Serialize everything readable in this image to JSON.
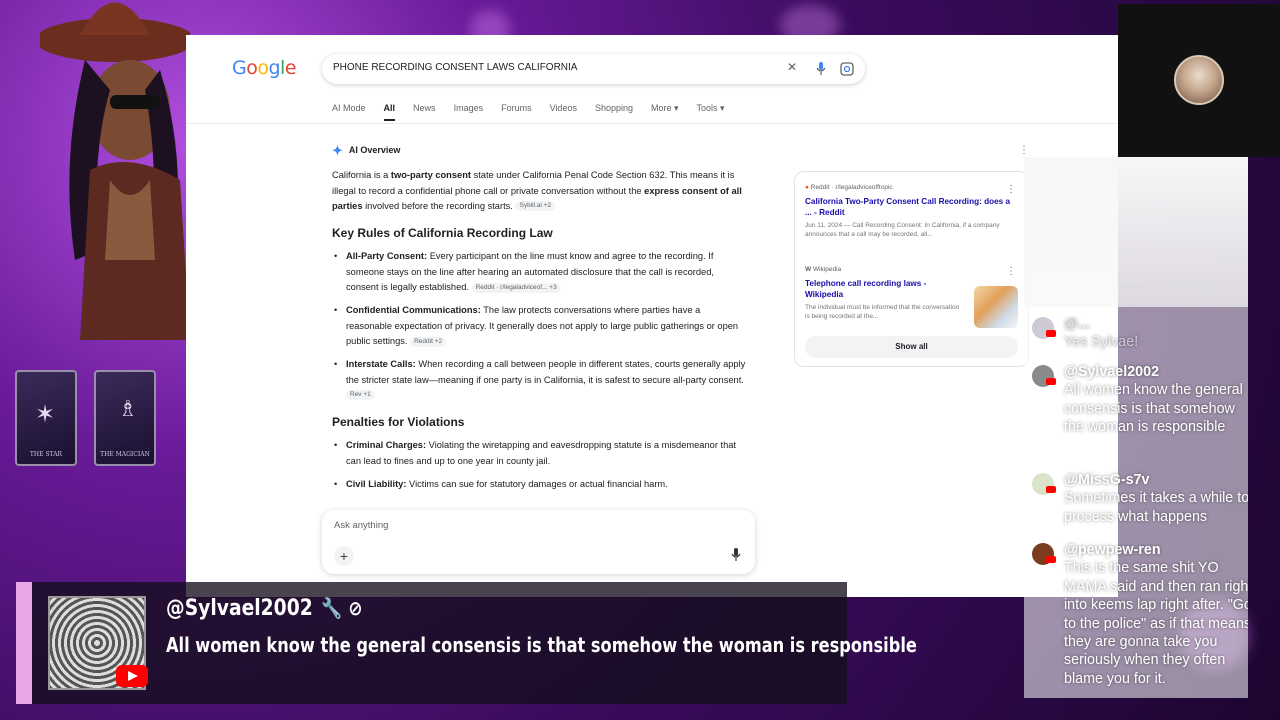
{
  "search": {
    "query": "PHONE RECORDING CONSENT LAWS CALIFORNIA",
    "tabs": [
      "AI Mode",
      "All",
      "News",
      "Images",
      "Forums",
      "Videos",
      "Shopping",
      "More ▾",
      "Tools ▾"
    ]
  },
  "overview": {
    "header": "AI Overview",
    "intro_1": "California is a ",
    "intro_bold_1": "two-party consent",
    "intro_2": " state under California Penal Code Section 632. This means it is illegal to record a confidential phone call or private conversation without the ",
    "intro_bold_2": "express consent of all parties",
    "intro_3": " involved before the recording starts.",
    "intro_chip": "Sybill.ai +2",
    "key_rules_heading": "Key Rules of California Recording Law",
    "rules": [
      {
        "title": "All-Party Consent:",
        "text": " Every participant on the line must know and agree to the recording. If someone stays on the line after hearing an automated disclosure that the call is recorded, consent is legally established.",
        "chip": "Reddit · r/legaladviceof... +3"
      },
      {
        "title": "Confidential Communications:",
        "text": " The law protects conversations where parties have a reasonable expectation of privacy. It generally does not apply to large public gatherings or open public settings.",
        "chip": "Reddit +2"
      },
      {
        "title": "Interstate Calls:",
        "text": " When recording a call between people in different states, courts generally apply the stricter state law—meaning if one party is in California, it is safest to secure all-party consent.",
        "chip": "Rev +1"
      }
    ],
    "penalties_heading": "Penalties for Violations",
    "penalties": [
      {
        "title": "Criminal Charges:",
        "text": " Violating the wiretapping and eavesdropping statute is a misdemeanor that can lead to fines and up to one year in county jail."
      },
      {
        "title": "Civil Liability:",
        "text": " Victims can sue for statutory damages or actual financial harm."
      }
    ]
  },
  "sources": {
    "items": [
      {
        "site": "Reddit · r/legaladviceofftopic",
        "title": "California Two-Party Consent Call Recording: does a ... - Reddit",
        "snippet": "Jun 11, 2024 — Call Recording Consent: In California, if a company announces that a call may be recorded, all..."
      },
      {
        "site": "Wikipedia",
        "title": "Telephone call recording laws - Wikipedia",
        "snippet": "The individual must be informed that the conversation is being recorded at the..."
      }
    ],
    "show_all": "Show all"
  },
  "ask": {
    "placeholder": "Ask anything",
    "plus": "+"
  },
  "chat": {
    "messages": [
      {
        "name": "@...",
        "text": "Yes Sylvae!",
        "avatar_color": "#cfc9d6"
      },
      {
        "name": "@Sylvael2002",
        "text": "All women know the general consensis is that somehow the woman is responsible",
        "avatar_color": "#8a8a8a"
      },
      {
        "name": "@MissG-s7v",
        "text": "Sometimes it takes a while to process what happens",
        "avatar_color": "#d9e4c8"
      },
      {
        "name": "@pewpew-ren",
        "text": "This is the same shit YO MAMA said and then ran right into keems lap right after. \"Go to the police\" as if that means they are gonna take you seriously when they often blame you for it.",
        "avatar_color": "#7a3b1f"
      }
    ]
  },
  "featured": {
    "name": "@Sylvael2002",
    "badges": "🔧 ⊘",
    "text": "All women know the general consensis is that somehow the woman is responsible"
  },
  "tarot": [
    "THE STAR",
    "THE MAGICIAN"
  ],
  "colors": {
    "accent": "#e8a8e8",
    "link": "#1a0dab",
    "google_blue": "#4285f4"
  }
}
